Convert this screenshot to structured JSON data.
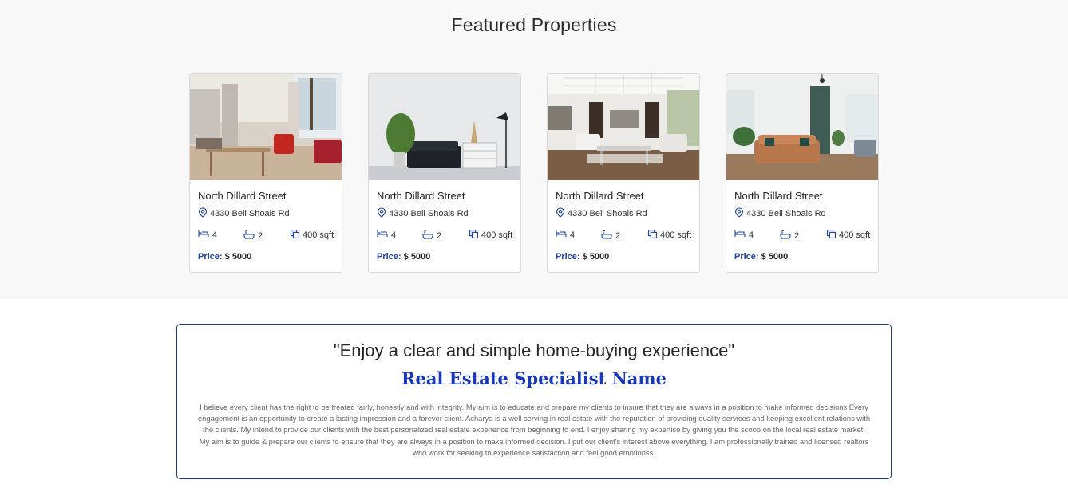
{
  "section": {
    "title": "Featured Properties"
  },
  "properties": [
    {
      "name": "North Dillard Street",
      "address": "4330 Bell Shoals Rd",
      "beds": "4",
      "baths": "2",
      "area": "400 sqft",
      "price_label": "Price:",
      "price": "$ 5000",
      "image": "kitchen-living-room-photo"
    },
    {
      "name": "North Dillard Street",
      "address": "4330 Bell Shoals Rd",
      "beds": "4",
      "baths": "2",
      "area": "400 sqft",
      "price_label": "Price:",
      "price": "$ 5000",
      "image": "sofa-dresser-room-photo"
    },
    {
      "name": "North Dillard Street",
      "address": "4330 Bell Shoals Rd",
      "beds": "4",
      "baths": "2",
      "area": "400 sqft",
      "price_label": "Price:",
      "price": "$ 5000",
      "image": "white-living-room-photo"
    },
    {
      "name": "North Dillard Street",
      "address": "4330 Bell Shoals Rd",
      "beds": "4",
      "baths": "2",
      "area": "400 sqft",
      "price_label": "Price:",
      "price": "$ 5000",
      "image": "leather-sofa-loft-photo"
    }
  ],
  "testimonial": {
    "quote": "\"Enjoy a clear and simple home-buying experience\"",
    "name": "Real Estate Specialist Name",
    "bio": "I believe every client has the right to be treated fairly, honestly and with integrity. My aim is to educate and prepare my clients to insure that they are always in a position to make informed decisions.Every engagement is an opportunity to create a lasting impression and a forever client. Acharya is a well serving in real estate with the reputation of providing quality services and keeping excellent relations with the clients. My intend to provide our clients with the best personalized real estate experience from beginning to end. I enjoy sharing my expertise by giving you the scoop on the local real estate market. My aim is to guide & prepare our clients to ensure that they are always in a position to make informed decision. I put our client's interest above everything. I am professionally trained and licensed realtors who work for seeking to experience satisfaction and feel good emotionss."
  },
  "colors": {
    "accent": "#1a3fa6",
    "heading": "#1838b5",
    "border": "#1b3a8c",
    "section_bg": "#f8f8f8"
  },
  "icons": {
    "location": "location-pin-icon",
    "bed": "bed-icon",
    "bath": "bathtub-icon",
    "area": "area-icon"
  }
}
